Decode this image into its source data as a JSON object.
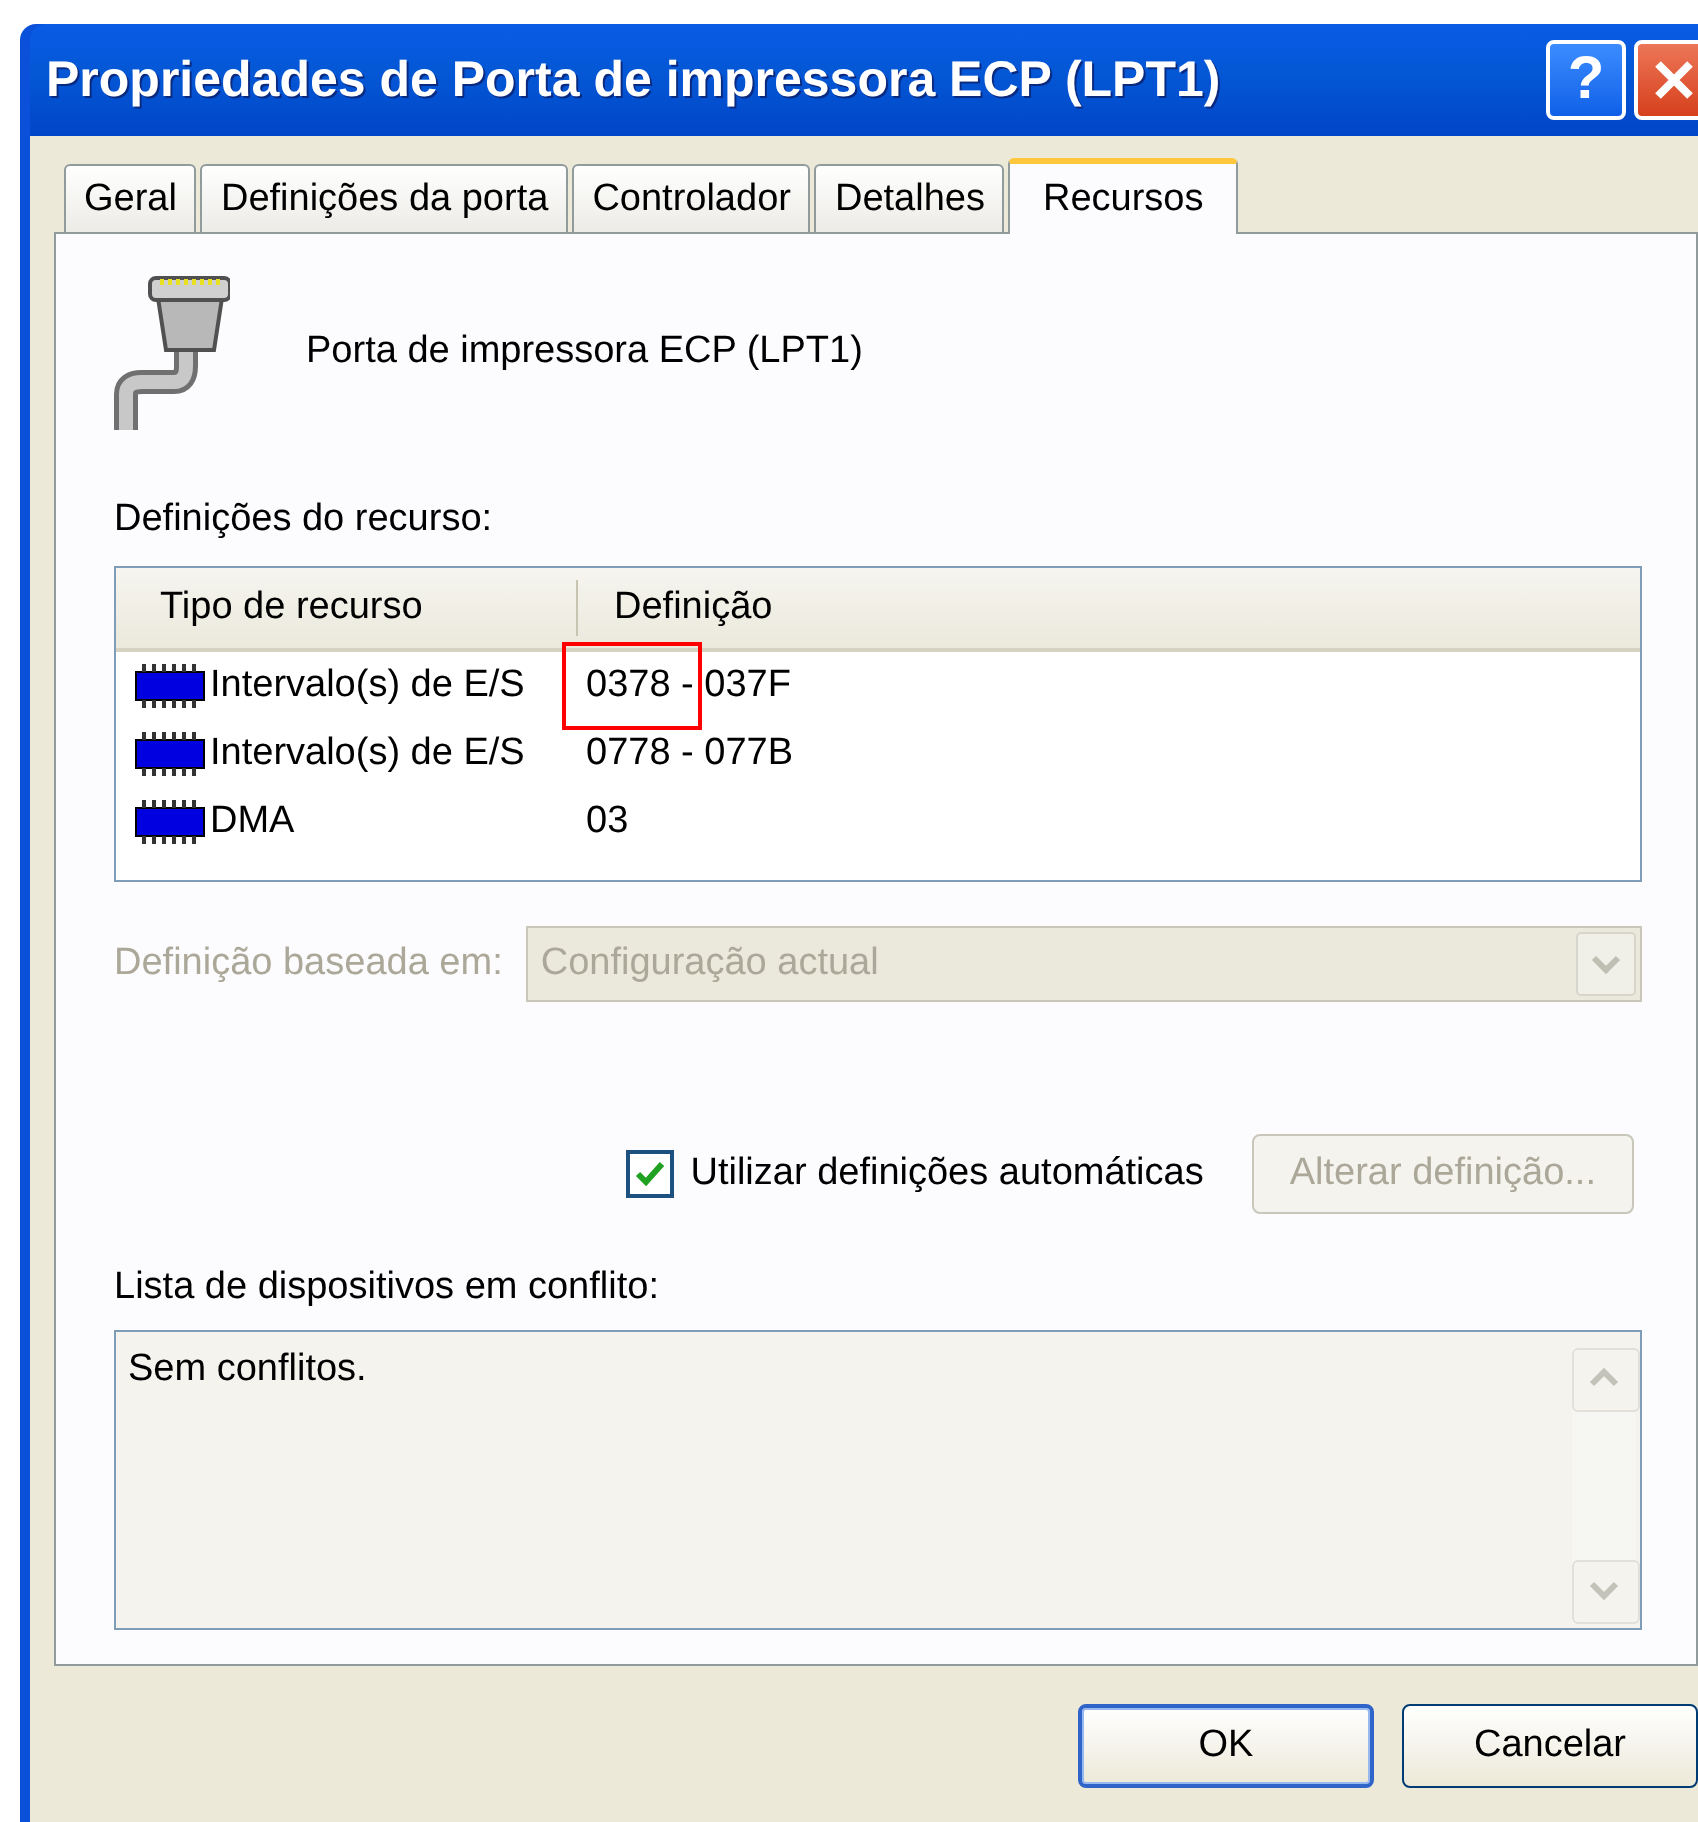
{
  "window": {
    "title": "Propriedades de Porta de impressora ECP (LPT1)",
    "help_button": "?"
  },
  "tabs": [
    {
      "label": "Geral",
      "selected": false
    },
    {
      "label": "Definições da porta",
      "selected": false
    },
    {
      "label": "Controlador",
      "selected": false
    },
    {
      "label": "Detalhes",
      "selected": false
    },
    {
      "label": "Recursos",
      "selected": true
    }
  ],
  "device": {
    "name": "Porta de impressora ECP (LPT1)"
  },
  "resources": {
    "label": "Definições do recurso:",
    "columns": [
      "Tipo de recurso",
      "Definição"
    ],
    "rows": [
      {
        "type": "Intervalo(s) de E/S",
        "setting": "0378 - 037F",
        "highlighted": true
      },
      {
        "type": "Intervalo(s) de E/S",
        "setting": "0778 - 077B",
        "highlighted": false
      },
      {
        "type": "DMA",
        "setting": "03",
        "highlighted": false
      }
    ]
  },
  "setting_based_on": {
    "label": "Definição baseada em:",
    "value": "Configuração actual",
    "disabled": true
  },
  "auto_settings": {
    "label": "Utilizar definições automáticas",
    "checked": true
  },
  "change_button": {
    "label": "Alterar definição...",
    "disabled": true
  },
  "conflicts": {
    "label": "Lista de dispositivos em conflito:",
    "text": "Sem conflitos."
  },
  "buttons": [
    {
      "label": "OK",
      "default": true
    },
    {
      "label": "Cancelar",
      "default": false
    }
  ]
}
